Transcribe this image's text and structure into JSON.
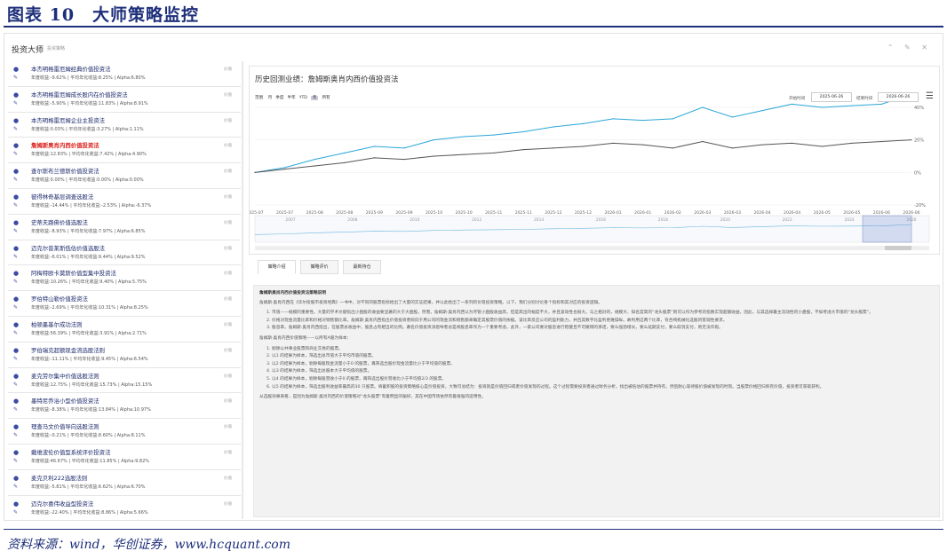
{
  "figure": {
    "title": "图表 10　大师策略监控",
    "source": "资料来源：wind，华创证券，www.hcquant.com"
  },
  "app": {
    "title": "投资大师",
    "subtitle": "投资策略",
    "controls": "⌃ ✎ ✕"
  },
  "strategies": [
    {
      "name": "本杰明格雷厄姆经典价值投资法",
      "stats": "年度收益:-9.62% | 平均年化收益:8.25% | Alpha:6.80%",
      "tag": "价值",
      "active": false
    },
    {
      "name": "本杰明格雷厄姆成长股内在价值投资法",
      "stats": "年度收益:-5.90% | 平均年化收益:11.83% | Alpha:8.91%",
      "tag": "价值",
      "active": false
    },
    {
      "name": "本杰明格雷厄姆企业主投资法",
      "stats": "年度收益:0.03% | 平均年化收益:3.27% | Alpha:1.11%",
      "tag": "价值",
      "active": false
    },
    {
      "name": "詹姆斯奥肖内西价值投资法",
      "stats": "年度收益:12.83% | 平均年化收益:7.42% | Alpha:4.90%",
      "tag": "价值",
      "active": true
    },
    {
      "name": "查尔斯布兰德斯价值投资法",
      "stats": "年度收益:0.00% | 平均年化收益:0.00% | Alpha:0.00%",
      "tag": "价值",
      "active": false
    },
    {
      "name": "彼得林奇基层调查选股法",
      "stats": "年度收益:-14.44% | 平均年化收益:-2.53% | Alpha:-6.37%",
      "tag": "价值",
      "active": false
    },
    {
      "name": "史蒂夫路佛价值选股法",
      "stats": "年度收益:-8.93% | 平均年化收益:7.97% | Alpha:6.85%",
      "tag": "价值",
      "active": false
    },
    {
      "name": "迈克尔普莱斯低估价值选股法",
      "stats": "年度收益:-6.01% | 平均年化收益:9.44% | Alpha:9.52%",
      "tag": "价值",
      "active": false
    },
    {
      "name": "阿梅特欧卡莫斯价值型集中投资法",
      "stats": "年度收益:10.26% | 平均年化收益:9.40% | Alpha:5.75%",
      "tag": "价值",
      "active": false
    },
    {
      "name": "罗伯特山勒价值投资法",
      "stats": "年度收益:-2.69% | 平均年化收益:10.31% | Alpha:8.25%",
      "tag": "价值",
      "active": false
    },
    {
      "name": "柏顿墨基尔成功法则",
      "stats": "年度收益:56.39% | 平均年化收益:3.91% | Alpha:2.71%",
      "tag": "价值",
      "active": false
    },
    {
      "name": "罗伯瑞克超额现金流选股法则",
      "stats": "年度收益:-11.11% | 平均年化收益:9.45% | Alpha:6.54%",
      "tag": "价值",
      "active": false
    },
    {
      "name": "麦克劳尔集中价值选股法则",
      "stats": "年度收益:12.75% | 平均年化收益:15.73% | Alpha:15.15%",
      "tag": "价值",
      "active": false
    },
    {
      "name": "墨特尼乔治小型价值投资法",
      "stats": "年度收益:-8.38% | 平均年化收益:13.84% | Alpha:10.97%",
      "tag": "价值",
      "active": false
    },
    {
      "name": "理查马文价值导向选股法则",
      "stats": "年度收益:-0.21% | 平均年化收益:8.60% | Alpha:8.11%",
      "tag": "价值",
      "active": false
    },
    {
      "name": "戴维波伦价值型系统评价投资法",
      "stats": "年度收益:46.67% | 平均年化收益:11.85% | Alpha:9.82%",
      "tag": "价值",
      "active": false
    },
    {
      "name": "麦克贝利222选股法则",
      "stats": "年度收益:-5.81% | 平均年化收益:6.62% | Alpha:6.70%",
      "tag": "价值",
      "active": false
    },
    {
      "name": "迈克尔喜伟收益型投资法",
      "stats": "年度收益:-22.40% | 平均年化收益:8.86% | Alpha:5.66%",
      "tag": "价值",
      "active": false
    }
  ],
  "chart_header": {
    "title": "历史回测业绩：詹姆斯奥肖内西价值投资法",
    "range_label": "范围",
    "ranges": [
      "月",
      "季度",
      "半年",
      "YTD",
      "年",
      "所有"
    ],
    "selected_range": "年",
    "start_label": "开始时间",
    "start_date": "2025-06-26",
    "end_label": "结束时间",
    "end_date": "2026-06-26"
  },
  "chart_data": {
    "type": "line",
    "x": [
      "2025-07",
      "2025-07",
      "2025-08",
      "2025-08",
      "2025-09",
      "2025-09",
      "2025-10",
      "2025-10",
      "2025-11",
      "2025-11",
      "2025-12",
      "2025-12",
      "2026-01",
      "2026-01",
      "2026-02",
      "2026-03",
      "2026-03",
      "2026-04",
      "2026-04",
      "2026-05",
      "2026-05",
      "2026-06",
      "2026-06"
    ],
    "ylim": [
      -20,
      40
    ],
    "yticks": [
      "40%",
      "20%",
      "0%",
      "-20%"
    ],
    "series": [
      {
        "color": "#2aa6d8",
        "values": [
          0,
          3,
          8,
          12,
          16,
          15,
          20,
          22,
          23,
          25,
          28,
          30,
          33,
          32,
          33,
          40,
          34,
          38,
          42,
          40,
          41,
          42,
          48
        ]
      },
      {
        "color": "#555555",
        "values": [
          0,
          2,
          4,
          6,
          9,
          8,
          10,
          11,
          12,
          14,
          15,
          16,
          18,
          17,
          15,
          19,
          15,
          17,
          18,
          16,
          18,
          19,
          20
        ]
      }
    ],
    "navigator_years": [
      "2007",
      "2008",
      "2010",
      "2012",
      "2014",
      "2016",
      "2018",
      "2020",
      "2022",
      "2024",
      "2026"
    ]
  },
  "tabs": [
    "策略介绍",
    "策略评价",
    "最新持仓"
  ],
  "description": {
    "heading": "詹姆斯奥肖内西价值投资法策略说明",
    "intro": "詹姆斯·奥肖内西在《华尔街股市投资经典》一书中，对不同的股票指标给出了大量的实证结果，并以此给出了一系列的价值投资策略。以下，我们分别讨论各个指标和其对应的投资逻辑。",
    "points": [
      "市值——规模的重要性。大量的学术文献指出小盘股的收益要显著的大于大盘股。然而，詹姆斯·奥肖内西认为尽管小盘股收益高，但是高出的幅度不大，并且波动性也很大。与之相对的，规模大、知名度高的“龙头股票”则可以作为参考的指数实现超额收益。因此，与其选择最主流动性的小盘股，不如考虑大市值的“龙头股票”。",
      "价格对现金流量比率和价格对销售额比率。詹姆斯·奥肖内西指出价值投资者倾向于用公司的现金流和销售额来确定其股票价值的依据。该比率反应公司的盈利能力，并且其数字比盈利更难操纵。故利用这两个比率，符合纯机械化选股的客观性要求。",
      "股息率。詹姆斯·奥肖内西指出，在股票总收益中，股息占有相当的比例。著名价值投资派倡导者总是将股息率作为一个重要考虑。此外，一家公司要对股息进行稳健且不可撤销的承诺，要么强劲增长，要么延期支付，要么取消支付，则无法作假。"
    ],
    "rule_title": "詹姆斯·奥肖内西价值策略——以所有A股为样本：",
    "rules": [
      "剔除公共事业股票和商业交易的股票。",
      "以1 的结果为样本，筛选出总市值大于平均市值的股票。",
      "以2 的结果为样本，剔除每股现金流量小于0 的股票，再筛选出股价现金流量比小于平均值的股票。",
      "以3 的结果为样本，筛选出总股本大于平均值的股票。",
      "以4 的结果为样本，剔除每股营收小于0 的股票，再筛选出股价营收比小于平均值2/3 的股票。",
      "以5 的结果为样本，筛选出股利收益率最高的30 只股票。将蓄积股的投资策略核心是价值投资，大致可总结为：投资就是价值回归或者价值发现的过程。这个过程需要投资者通过财务分析，找出被低估的股票并持有，然后耐心等待股价值被发现的时刻。当股票价格回归到有价值，投资者可获取获利。"
    ],
    "conclusion": "从选股效果来看，是因为詹姆斯·奥肖内西的价值策略对“龙头股票”有着明显的偏好，其在中国市场依然有着很强的适用性。"
  }
}
